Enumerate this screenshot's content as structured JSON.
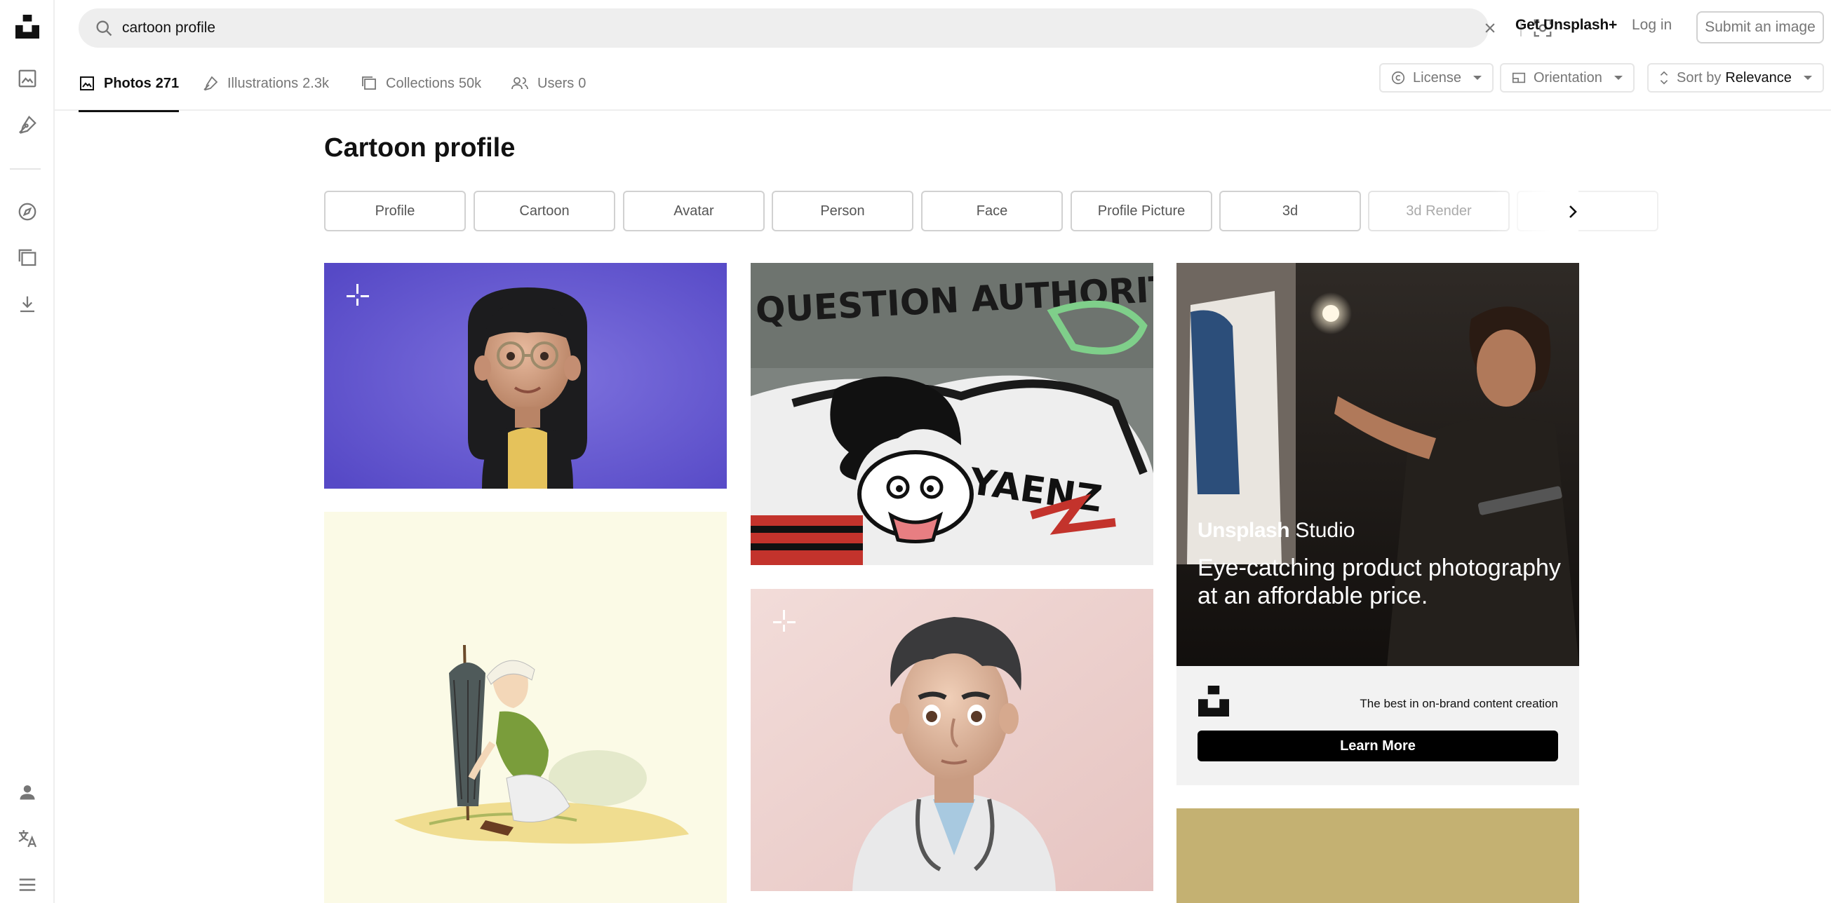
{
  "search": {
    "value": "cartoon profile"
  },
  "header": {
    "get_plus": "Get Unsplash+",
    "login": "Log in",
    "submit": "Submit an image"
  },
  "tabs": [
    {
      "label": "Photos",
      "count": "271",
      "active": true
    },
    {
      "label": "Illustrations",
      "count": "2.3k"
    },
    {
      "label": "Collections",
      "count": "50k"
    },
    {
      "label": "Users",
      "count": "0"
    }
  ],
  "filters": {
    "license": "License",
    "orientation": "Orientation",
    "sort_prefix": "Sort by",
    "sort_value": "Relevance"
  },
  "page_title": "Cartoon profile",
  "related": [
    "Profile",
    "Cartoon",
    "Avatar",
    "Person",
    "Face",
    "Profile Picture",
    "3d",
    "3d Render"
  ],
  "ad": {
    "brand_bold": "Unsplash",
    "brand_light": "Studio",
    "headline": "Eye-catching product photography at an affordable price.",
    "tagline": "The best in on-brand content creation",
    "button": "Learn More"
  },
  "photos": [
    {
      "name": "photo-3d-girl-glasses",
      "bg": "#6b5fd6",
      "plus": true
    },
    {
      "name": "photo-graffiti-cartoon",
      "bg": "#8a8f8a",
      "plus": false
    },
    {
      "name": "photo-ad-studio",
      "bg": "#2a2420",
      "plus": false
    },
    {
      "name": "photo-vintage-illustration",
      "bg": "#fbfae6",
      "plus": false
    },
    {
      "name": "photo-3d-doctor",
      "bg": "#efd6d4",
      "plus": true
    },
    {
      "name": "photo-olive-solid",
      "bg": "#c4b172",
      "plus": false
    }
  ]
}
